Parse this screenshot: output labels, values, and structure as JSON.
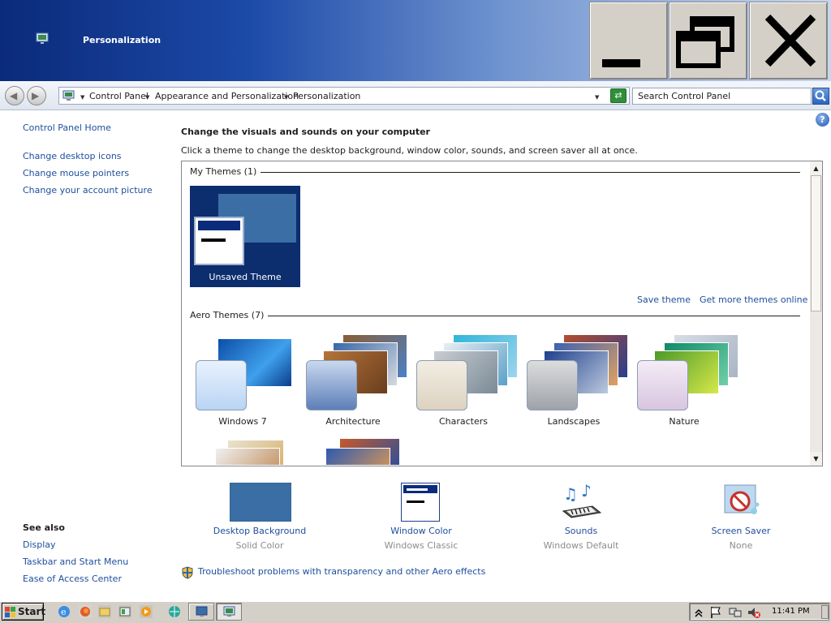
{
  "window": {
    "title": "Personalization",
    "icon": "personalization-monitor-icon"
  },
  "address_bar": {
    "breadcrumbs": [
      "Control Panel",
      "Appearance and Personalization",
      "Personalization"
    ],
    "search_placeholder": "Search Control Panel"
  },
  "left_pane": {
    "home_link": "Control Panel Home",
    "links": [
      "Change desktop icons",
      "Change mouse pointers",
      "Change your account picture"
    ],
    "see_also_title": "See also",
    "see_also_links": [
      "Display",
      "Taskbar and Start Menu",
      "Ease of Access Center"
    ]
  },
  "main": {
    "title": "Change the visuals and sounds on your computer",
    "subtitle": "Click a theme to change the desktop background, window color, sounds, and screen saver all at once.",
    "help_glyph": "?"
  },
  "themes": {
    "my_themes_label": "My Themes (1)",
    "unsaved_theme_name": "Unsaved Theme",
    "save_theme_link": "Save theme",
    "get_more_link": "Get more themes online",
    "aero_label": "Aero Themes (7)",
    "aero_items": [
      {
        "name": "Windows 7",
        "color": "#1565c8",
        "color2": "#4aa3e8"
      },
      {
        "name": "Architecture",
        "color": "#3a6fb0",
        "color2": "#b5743a"
      },
      {
        "name": "Characters",
        "color": "#3fa6c8",
        "color2": "#c9d7e3"
      },
      {
        "name": "Landscapes",
        "color": "#2c4f9c",
        "color2": "#b54c2b"
      },
      {
        "name": "Nature",
        "color": "#1e9a5a",
        "color2": "#c9cfd8"
      }
    ]
  },
  "bottom_tiles": [
    {
      "label": "Desktop Background",
      "sub": "Solid Color",
      "icon": "desktop-background-icon"
    },
    {
      "label": "Window Color",
      "sub": "Windows Classic",
      "icon": "window-color-icon"
    },
    {
      "label": "Sounds",
      "sub": "Windows Default",
      "icon": "sounds-icon"
    },
    {
      "label": "Screen Saver",
      "sub": "None",
      "icon": "screen-saver-icon"
    }
  ],
  "troubleshoot_link": "Troubleshoot problems with transparency and other Aero effects",
  "taskbar": {
    "start_label": "Start",
    "clock": "11:41 PM"
  },
  "colors": {
    "link": "#1d4e9c",
    "title_gradient_start": "#0b2a7a",
    "desktop_background": "#3a6ea5"
  }
}
